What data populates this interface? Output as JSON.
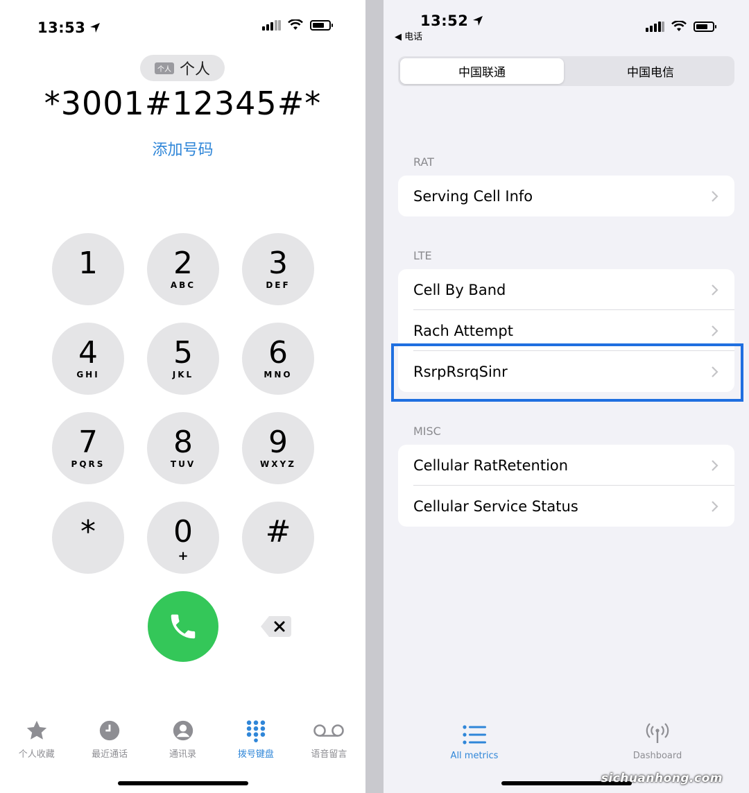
{
  "left_phone": {
    "status_time": "13:53",
    "sim_badge": "个人",
    "sim_label": "个人",
    "dialed_number": "*3001#12345#*",
    "add_number_label": "添加号码",
    "keys": [
      {
        "digit": "1",
        "letters": ""
      },
      {
        "digit": "2",
        "letters": "ABC"
      },
      {
        "digit": "3",
        "letters": "DEF"
      },
      {
        "digit": "4",
        "letters": "GHI"
      },
      {
        "digit": "5",
        "letters": "JKL"
      },
      {
        "digit": "6",
        "letters": "MNO"
      },
      {
        "digit": "7",
        "letters": "PQRS"
      },
      {
        "digit": "8",
        "letters": "TUV"
      },
      {
        "digit": "9",
        "letters": "WXYZ"
      },
      {
        "digit": "*",
        "letters": ""
      },
      {
        "digit": "0",
        "letters": "+"
      },
      {
        "digit": "#",
        "letters": ""
      }
    ],
    "tabs": [
      {
        "label": "个人收藏",
        "icon": "star-icon"
      },
      {
        "label": "最近通话",
        "icon": "clock-icon"
      },
      {
        "label": "通讯录",
        "icon": "contact-icon"
      },
      {
        "label": "拨号键盘",
        "icon": "keypad-icon",
        "active": true
      },
      {
        "label": "语音留言",
        "icon": "voicemail-icon"
      }
    ]
  },
  "right_phone": {
    "status_time": "13:52",
    "back_app": "◀ 电话",
    "segments": [
      "中国联通",
      "中国电信"
    ],
    "sections": [
      {
        "header": "RAT",
        "rows": [
          "Serving Cell Info"
        ]
      },
      {
        "header": "LTE",
        "rows": [
          "Cell By Band",
          "Rach Attempt",
          "RsrpRsrqSinr"
        ]
      },
      {
        "header": "MISC",
        "rows": [
          "Cellular RatRetention",
          "Cellular Service Status"
        ]
      }
    ],
    "tabs": [
      {
        "label": "All metrics",
        "icon": "list-icon",
        "active": true
      },
      {
        "label": "Dashboard",
        "icon": "antenna-icon"
      }
    ]
  },
  "watermark": "sichuanhong.com",
  "colors": {
    "accent": "#2f86d8",
    "call_green": "#34c759",
    "highlight_box": "#1f6fe0"
  }
}
